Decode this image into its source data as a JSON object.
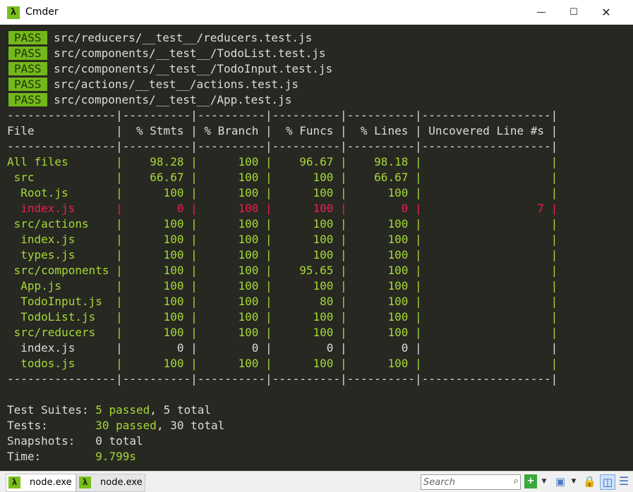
{
  "window": {
    "title": "Cmder",
    "minimize": "—",
    "maximize": "☐",
    "close": "✕"
  },
  "colors": {
    "terminal_bg": "#272822",
    "pass_badge": "#73b81a",
    "green_text": "#a6d837",
    "red_text": "#e8214f",
    "default_text": "#dcdcdc"
  },
  "terminal": {
    "pass_lines": [
      {
        "badge": "PASS",
        "path": "src/reducers/__test__/reducers.test.js"
      },
      {
        "badge": "PASS",
        "path": "src/components/__test__/TodoList.test.js"
      },
      {
        "badge": "PASS",
        "path": "src/components/__test__/TodoInput.test.js"
      },
      {
        "badge": "PASS",
        "path": "src/actions/__test__/actions.test.js"
      },
      {
        "badge": "PASS",
        "path": "src/components/__test__/App.test.js"
      }
    ],
    "separator": "----------------|----------|----------|----------|----------|-------------------|",
    "header": "File            |  % Stmts | % Branch |  % Funcs |  % Lines | Uncovered Line #s |",
    "rows": [
      {
        "text": "All files       |    98.28 |      100 |    96.67 |    98.18 |                   |",
        "color": "green"
      },
      {
        "text": " src            |    66.67 |      100 |      100 |    66.67 |                   |",
        "color": "mixed"
      },
      {
        "text": "  Root.js       |      100 |      100 |      100 |      100 |                   |",
        "color": "green"
      },
      {
        "text": "  index.js      |        0 |      100 |      100 |        0 |                 7 |",
        "color": "red"
      },
      {
        "text": " src/actions    |      100 |      100 |      100 |      100 |                   |",
        "color": "green"
      },
      {
        "text": "  index.js      |      100 |      100 |      100 |      100 |                   |",
        "color": "green"
      },
      {
        "text": "  types.js      |      100 |      100 |      100 |      100 |                   |",
        "color": "green"
      },
      {
        "text": " src/components |      100 |      100 |    95.65 |      100 |                   |",
        "color": "green"
      },
      {
        "text": "  App.js        |      100 |      100 |      100 |      100 |                   |",
        "color": "green"
      },
      {
        "text": "  TodoInput.js  |      100 |      100 |       80 |      100 |                   |",
        "color": "green"
      },
      {
        "text": "  TodoList.js   |      100 |      100 |      100 |      100 |                   |",
        "color": "green"
      },
      {
        "text": " src/reducers   |      100 |      100 |      100 |      100 |                   |",
        "color": "green"
      },
      {
        "text": "  index.js      |        0 |        0 |        0 |        0 |                   |",
        "color": "white"
      },
      {
        "text": "  todos.js      |      100 |      100 |      100 |      100 |                   |",
        "color": "green"
      }
    ],
    "summary": {
      "suites_label": "Test Suites: ",
      "suites_passed": "5 passed",
      "suites_total": ", 5 total",
      "tests_label": "Tests:       ",
      "tests_passed": "30 passed",
      "tests_total": ", 30 total",
      "snapshots_label": "Snapshots:   ",
      "snapshots_value": "0 total",
      "time_label": "Time:        ",
      "time_value": "9.799s"
    }
  },
  "statusbar": {
    "tabs": [
      {
        "icon": "lambda-icon",
        "glyph": "λ",
        "label": "node.exe"
      },
      {
        "icon": "lambda-icon",
        "glyph": "λ",
        "label": "node.exe"
      }
    ],
    "search_placeholder": "Search",
    "tools": {
      "new_console": "+",
      "dropdown": "▼",
      "window": "▣",
      "lock": "🔒",
      "panel": "◫",
      "menu": "☰",
      "search": "⌕"
    }
  }
}
